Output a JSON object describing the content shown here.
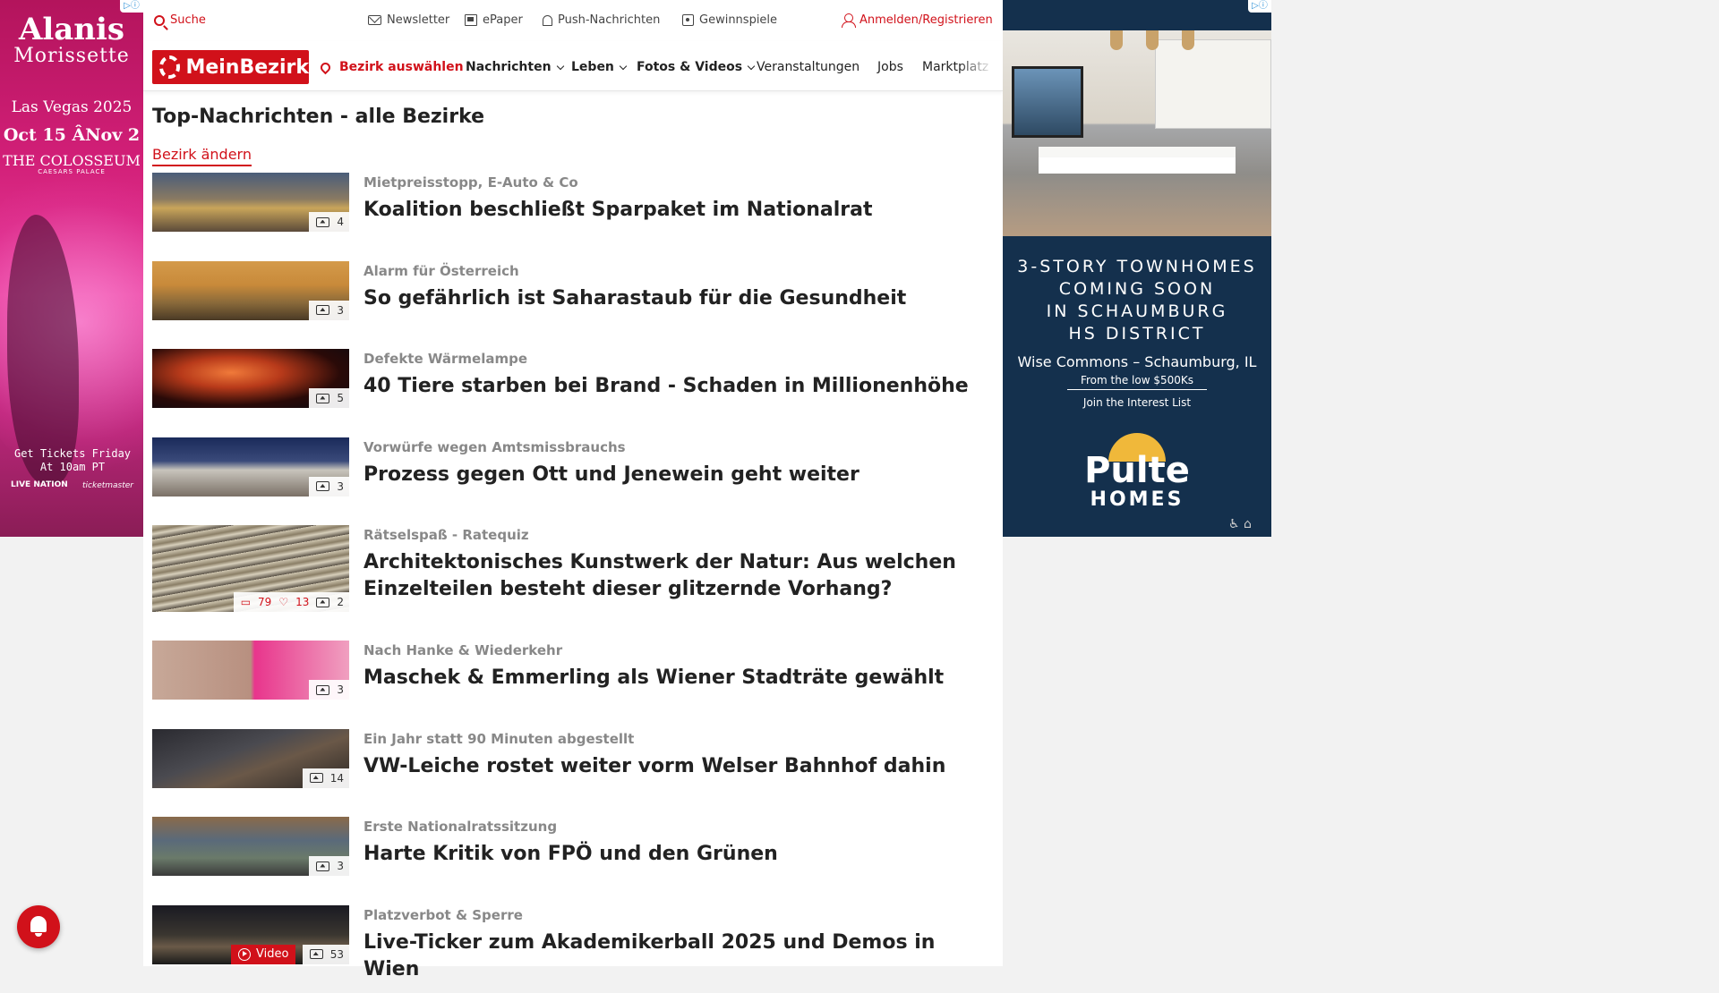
{
  "left_ad": {
    "artist": "Alanis",
    "artist2": "Morissette",
    "venue_line": "Las Vegas 2025",
    "dates": "Oct 15 ÂNov 2",
    "venue": "THE COLOSSEUM",
    "venue_sub": "CAESARS PALACE",
    "cta": "Get Tickets Friday At 10am PT",
    "sponsor1": "LIVE NATION",
    "sponsor2": "ticketmaster"
  },
  "topbar": {
    "search": "Suche",
    "newsletter": "Newsletter",
    "epaper": "ePaper",
    "push": "Push-Nachrichten",
    "games": "Gewinnspiele",
    "login": "Anmelden/Registrieren"
  },
  "nav": {
    "logo": "MeinBezirk",
    "district": "Bezirk auswählen",
    "items": [
      "Nachrichten",
      "Leben",
      "Fotos & Videos",
      "Veranstaltungen",
      "Jobs",
      "Marktplatz"
    ]
  },
  "page": {
    "title": "Top-Nachrichten - alle Bezirke",
    "change_link": "Bezirk ändern"
  },
  "articles": [
    {
      "kicker": "Mietpreisstopp, E-Auto & Co",
      "headline": "Koalition beschließt Sparpaket im Nationalrat",
      "photos": "4"
    },
    {
      "kicker": "Alarm für Österreich",
      "headline": "So gefährlich ist Saharastaub für die Gesundheit",
      "photos": "3"
    },
    {
      "kicker": "Defekte Wärmelampe",
      "headline": "40 Tiere starben bei Brand - Schaden in Millionenhöhe",
      "photos": "5"
    },
    {
      "kicker": "Vorwürfe wegen Amtsmissbrauchs",
      "headline": "Prozess gegen Ott und Jenewein geht weiter",
      "photos": "3"
    },
    {
      "kicker": "Rätselspaß - Ratequiz",
      "headline": "Architektonisches Kunstwerk der Natur: Aus welchen Einzelteilen besteht dieser glitzernde Vorhang?",
      "comments": "79",
      "likes": "13",
      "photos": "2"
    },
    {
      "kicker": "Nach Hanke & Wiederkehr",
      "headline": "Maschek & Emmerling als Wiener Stadträte gewählt",
      "photos": "3"
    },
    {
      "kicker": "Ein Jahr statt 90 Minuten abgestellt",
      "headline": "VW-Leiche rostet weiter vorm Welser Bahnhof dahin",
      "photos": "14"
    },
    {
      "kicker": "Erste Nationalratssitzung",
      "headline": "Harte Kritik von FPÖ und den Grünen",
      "photos": "3"
    },
    {
      "kicker": "Platzverbot & Sperre",
      "headline": "Live-Ticker zum Akademikerball 2025 und Demos in Wien",
      "video": "Video",
      "photos": "53"
    }
  ],
  "right_ad": {
    "line1": "3-STORY TOWNHOMES",
    "line2": "COMING SOON",
    "line3": "IN SCHAUMBURG",
    "line4": "HS DISTRICT",
    "location": "Wise Commons – Schaumburg, IL",
    "price": "From the low $500Ks",
    "cta": "Join the Interest List",
    "brand": "Pulte",
    "brand2": "HOMES"
  },
  "colors": {
    "brand_red": "#d1111a",
    "ad_navy": "#14304d"
  }
}
